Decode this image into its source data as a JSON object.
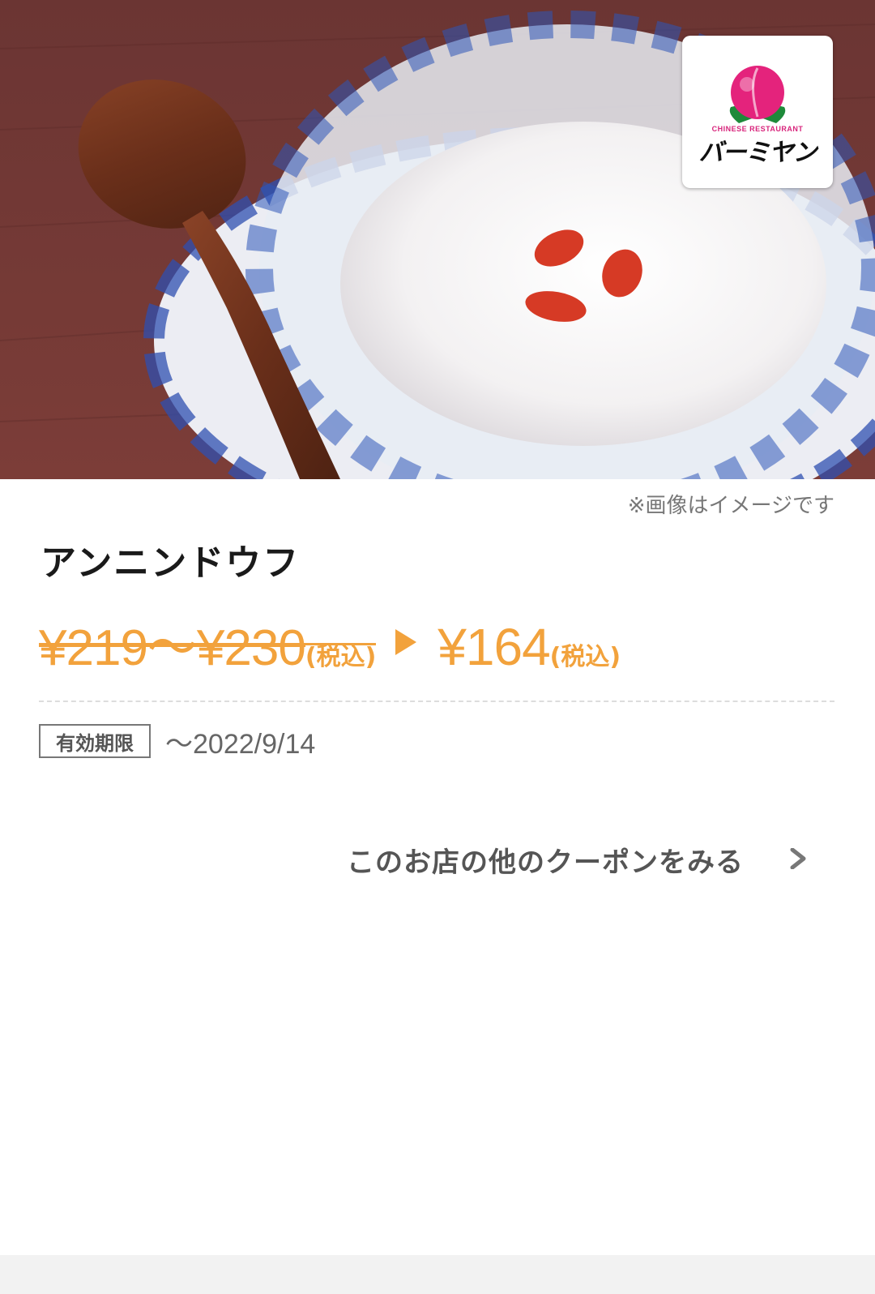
{
  "hero": {
    "image_subject": "annin-tofu-dessert-photo"
  },
  "logo": {
    "subtitle": "CHINESE RESTAURANT",
    "name": "バーミヤン"
  },
  "image_note": "※画像はイメージです",
  "item": {
    "title": "アンニンドウフ"
  },
  "price": {
    "original": "¥219〜¥230",
    "original_tax": "(税込)",
    "discounted": "¥164",
    "discounted_tax": "(税込)",
    "color": "#f2a23c"
  },
  "validity": {
    "label": "有効期限",
    "date": "〜2022/9/14"
  },
  "more_coupons": {
    "label": "このお店の他のクーポンをみる",
    "icon": "chevron-right-icon"
  }
}
